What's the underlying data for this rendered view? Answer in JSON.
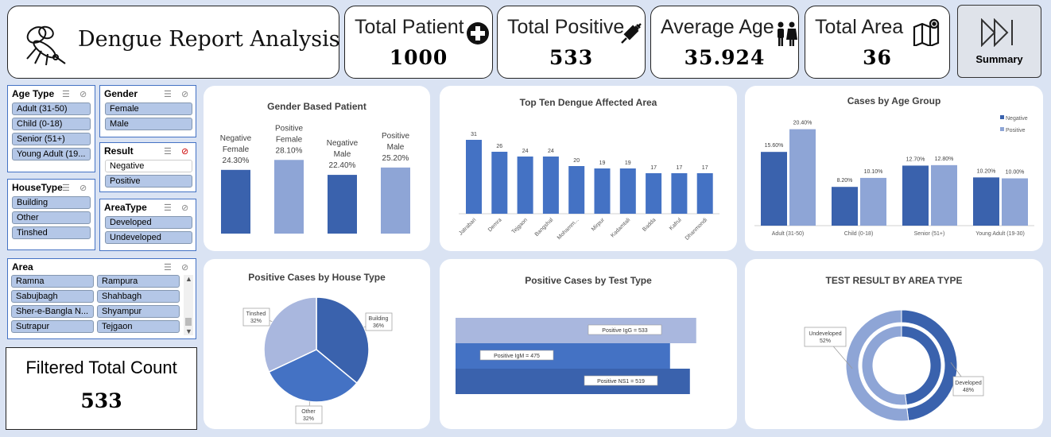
{
  "header": {
    "title": "Dengue Report Analysis"
  },
  "kpis": [
    {
      "title": "Total Patient",
      "value": "1000",
      "icon": "plus-circle-icon"
    },
    {
      "title": "Total Positive",
      "value": "533",
      "icon": "syringe-icon"
    },
    {
      "title": "Average Age",
      "value": "35.924",
      "icon": "people-icon"
    },
    {
      "title": "Total Area",
      "value": "36",
      "icon": "map-icon"
    }
  ],
  "summary": {
    "label": "Summary",
    "icon": "skip-forward-icon"
  },
  "slicers": {
    "age_type": {
      "title": "Age Type",
      "items": [
        "Adult (31-50)",
        "Child (0-18)",
        "Senior (51+)",
        "Young Adult (19..."
      ]
    },
    "gender": {
      "title": "Gender",
      "items": [
        "Female",
        "Male"
      ]
    },
    "result": {
      "title": "Result",
      "items": [
        "Negative",
        "Positive"
      ],
      "selected": "Positive"
    },
    "house_type": {
      "title": "HouseType",
      "items": [
        "Building",
        "Other",
        "Tinshed"
      ]
    },
    "area_type": {
      "title": "AreaType",
      "items": [
        "Developed",
        "Undeveloped"
      ]
    },
    "area": {
      "title": "Area",
      "items": [
        "Ramna",
        "Rampura",
        "Sabujbagh",
        "Shahbagh",
        "Sher-e-Bangla N...",
        "Shyampur",
        "Sutrapur",
        "Tejgaon"
      ]
    }
  },
  "filtered": {
    "label": "Filtered Total Count",
    "value": "533"
  },
  "colors": {
    "dark": "#3a62ad",
    "light": "#8ea5d6",
    "mid": "#4472c4",
    "pale": "#a9b7de"
  },
  "chart_data": [
    {
      "type": "bar",
      "title": "Gender Based Patient",
      "categories": [
        "Negative Female",
        "Positive Female",
        "Negative Male",
        "Positive Male"
      ],
      "label_lines": [
        [
          "Negative",
          "Female"
        ],
        [
          "Positive",
          "Female"
        ],
        [
          "Negative",
          "Male"
        ],
        [
          "Positive",
          "Male"
        ]
      ],
      "values": [
        24.3,
        28.1,
        22.4,
        25.2
      ],
      "labels": [
        "24.30%",
        "28.10%",
        "22.40%",
        "25.20%"
      ]
    },
    {
      "type": "bar",
      "title": "Top Ten Dengue Affected Area",
      "categories": [
        "Jatrabari",
        "Demra",
        "Tejgaon",
        "Bangshal",
        "Mohamm...",
        "Mirpur",
        "Kadamtali",
        "Badda",
        "Kafrul",
        "Dhanmondi"
      ],
      "values": [
        31,
        26,
        24,
        24,
        20,
        19,
        19,
        17,
        17,
        17
      ]
    },
    {
      "type": "bar",
      "title": "Cases by Age Group",
      "categories": [
        "Adult (31-50)",
        "Child (0-18)",
        "Senior (51+)",
        "Young Adult (19-30)"
      ],
      "series": [
        {
          "name": "Negative",
          "values": [
            15.6,
            8.2,
            12.7,
            10.2
          ],
          "labels": [
            "15.60%",
            "8.20%",
            "12.70%",
            "10.20%"
          ]
        },
        {
          "name": "Positive",
          "values": [
            20.4,
            10.1,
            12.8,
            10.0
          ],
          "labels": [
            "20.40%",
            "10.10%",
            "12.80%",
            "10.00%"
          ]
        }
      ],
      "legend": "top-right"
    },
    {
      "type": "pie",
      "title": "Positive Cases by House Type",
      "categories": [
        "Building",
        "Other",
        "Tinshed"
      ],
      "values": [
        36,
        32,
        32
      ],
      "labels": [
        "36%",
        "32%",
        "32%"
      ]
    },
    {
      "type": "bar",
      "title": "Positive Cases by Test Type",
      "categories": [
        "Positive IgG",
        "Positive IgM",
        "Positive NS1"
      ],
      "values": [
        533,
        475,
        519
      ],
      "labels": [
        "Positive IgG = 533",
        "Positive IgM = 475",
        "Positive NS1 = 519"
      ]
    },
    {
      "type": "pie",
      "title": "TEST RESULT BY AREA TYPE",
      "categories": [
        "Developed",
        "Undeveloped"
      ],
      "values": [
        48,
        52
      ],
      "labels": [
        "48%",
        "52%"
      ]
    }
  ]
}
